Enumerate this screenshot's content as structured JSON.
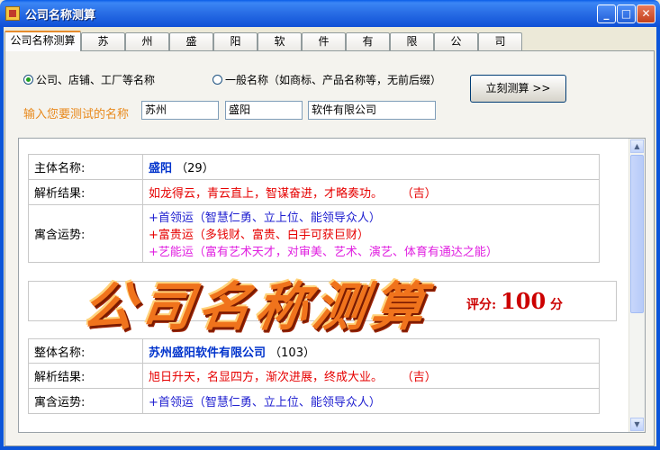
{
  "window": {
    "title": "公司名称测算"
  },
  "tabs": [
    "公司名称测算",
    "苏",
    "州",
    "盛",
    "阳",
    "软",
    "件",
    "有",
    "限",
    "公",
    "司"
  ],
  "options": {
    "radio1": "公司、店铺、工厂等名称",
    "radio2": "一般名称（如商标、产品名称等，无前后缀）",
    "calc_button": "立刻测算 >>",
    "prompt": "输入您要测试的名称",
    "fields": [
      "苏州",
      "盛阳",
      "软件有限公司"
    ]
  },
  "main": {
    "label_name": "主体名称:",
    "name": "盛阳",
    "name_num": "（29）",
    "label_analysis": "解析结果:",
    "analysis": "如龙得云，青云直上，智谋奋进，才略奏功。",
    "analysis_verdict": "（吉）",
    "label_fortune": "寓含运势:",
    "fortunes": [
      "+首领运（智慧仁勇、立上位、能领导众人）",
      "+富贵运（多钱财、富贵、白手可获巨财）",
      "+艺能运（富有艺术天才，对审美、艺术、演艺、体育有通达之能）"
    ]
  },
  "banner": {
    "text": "公司名称测算",
    "score_label": "评分:",
    "score_value": "100",
    "score_unit": "分"
  },
  "overall": {
    "label_name": "整体名称:",
    "name": "苏州盛阳软件有限公司",
    "name_num": "（103）",
    "label_analysis": "解析结果:",
    "analysis": "旭日升天，名显四方，渐次进展，终成大业。",
    "analysis_verdict": "（吉）",
    "label_fortune": "寓含运势:",
    "fortunes": [
      "+首领运（智慧仁勇、立上位、能领导众人）"
    ]
  },
  "icons": {
    "minimize": "minimize-icon",
    "maximize": "maximize-icon",
    "close": "close-icon",
    "app": "app-icon"
  }
}
